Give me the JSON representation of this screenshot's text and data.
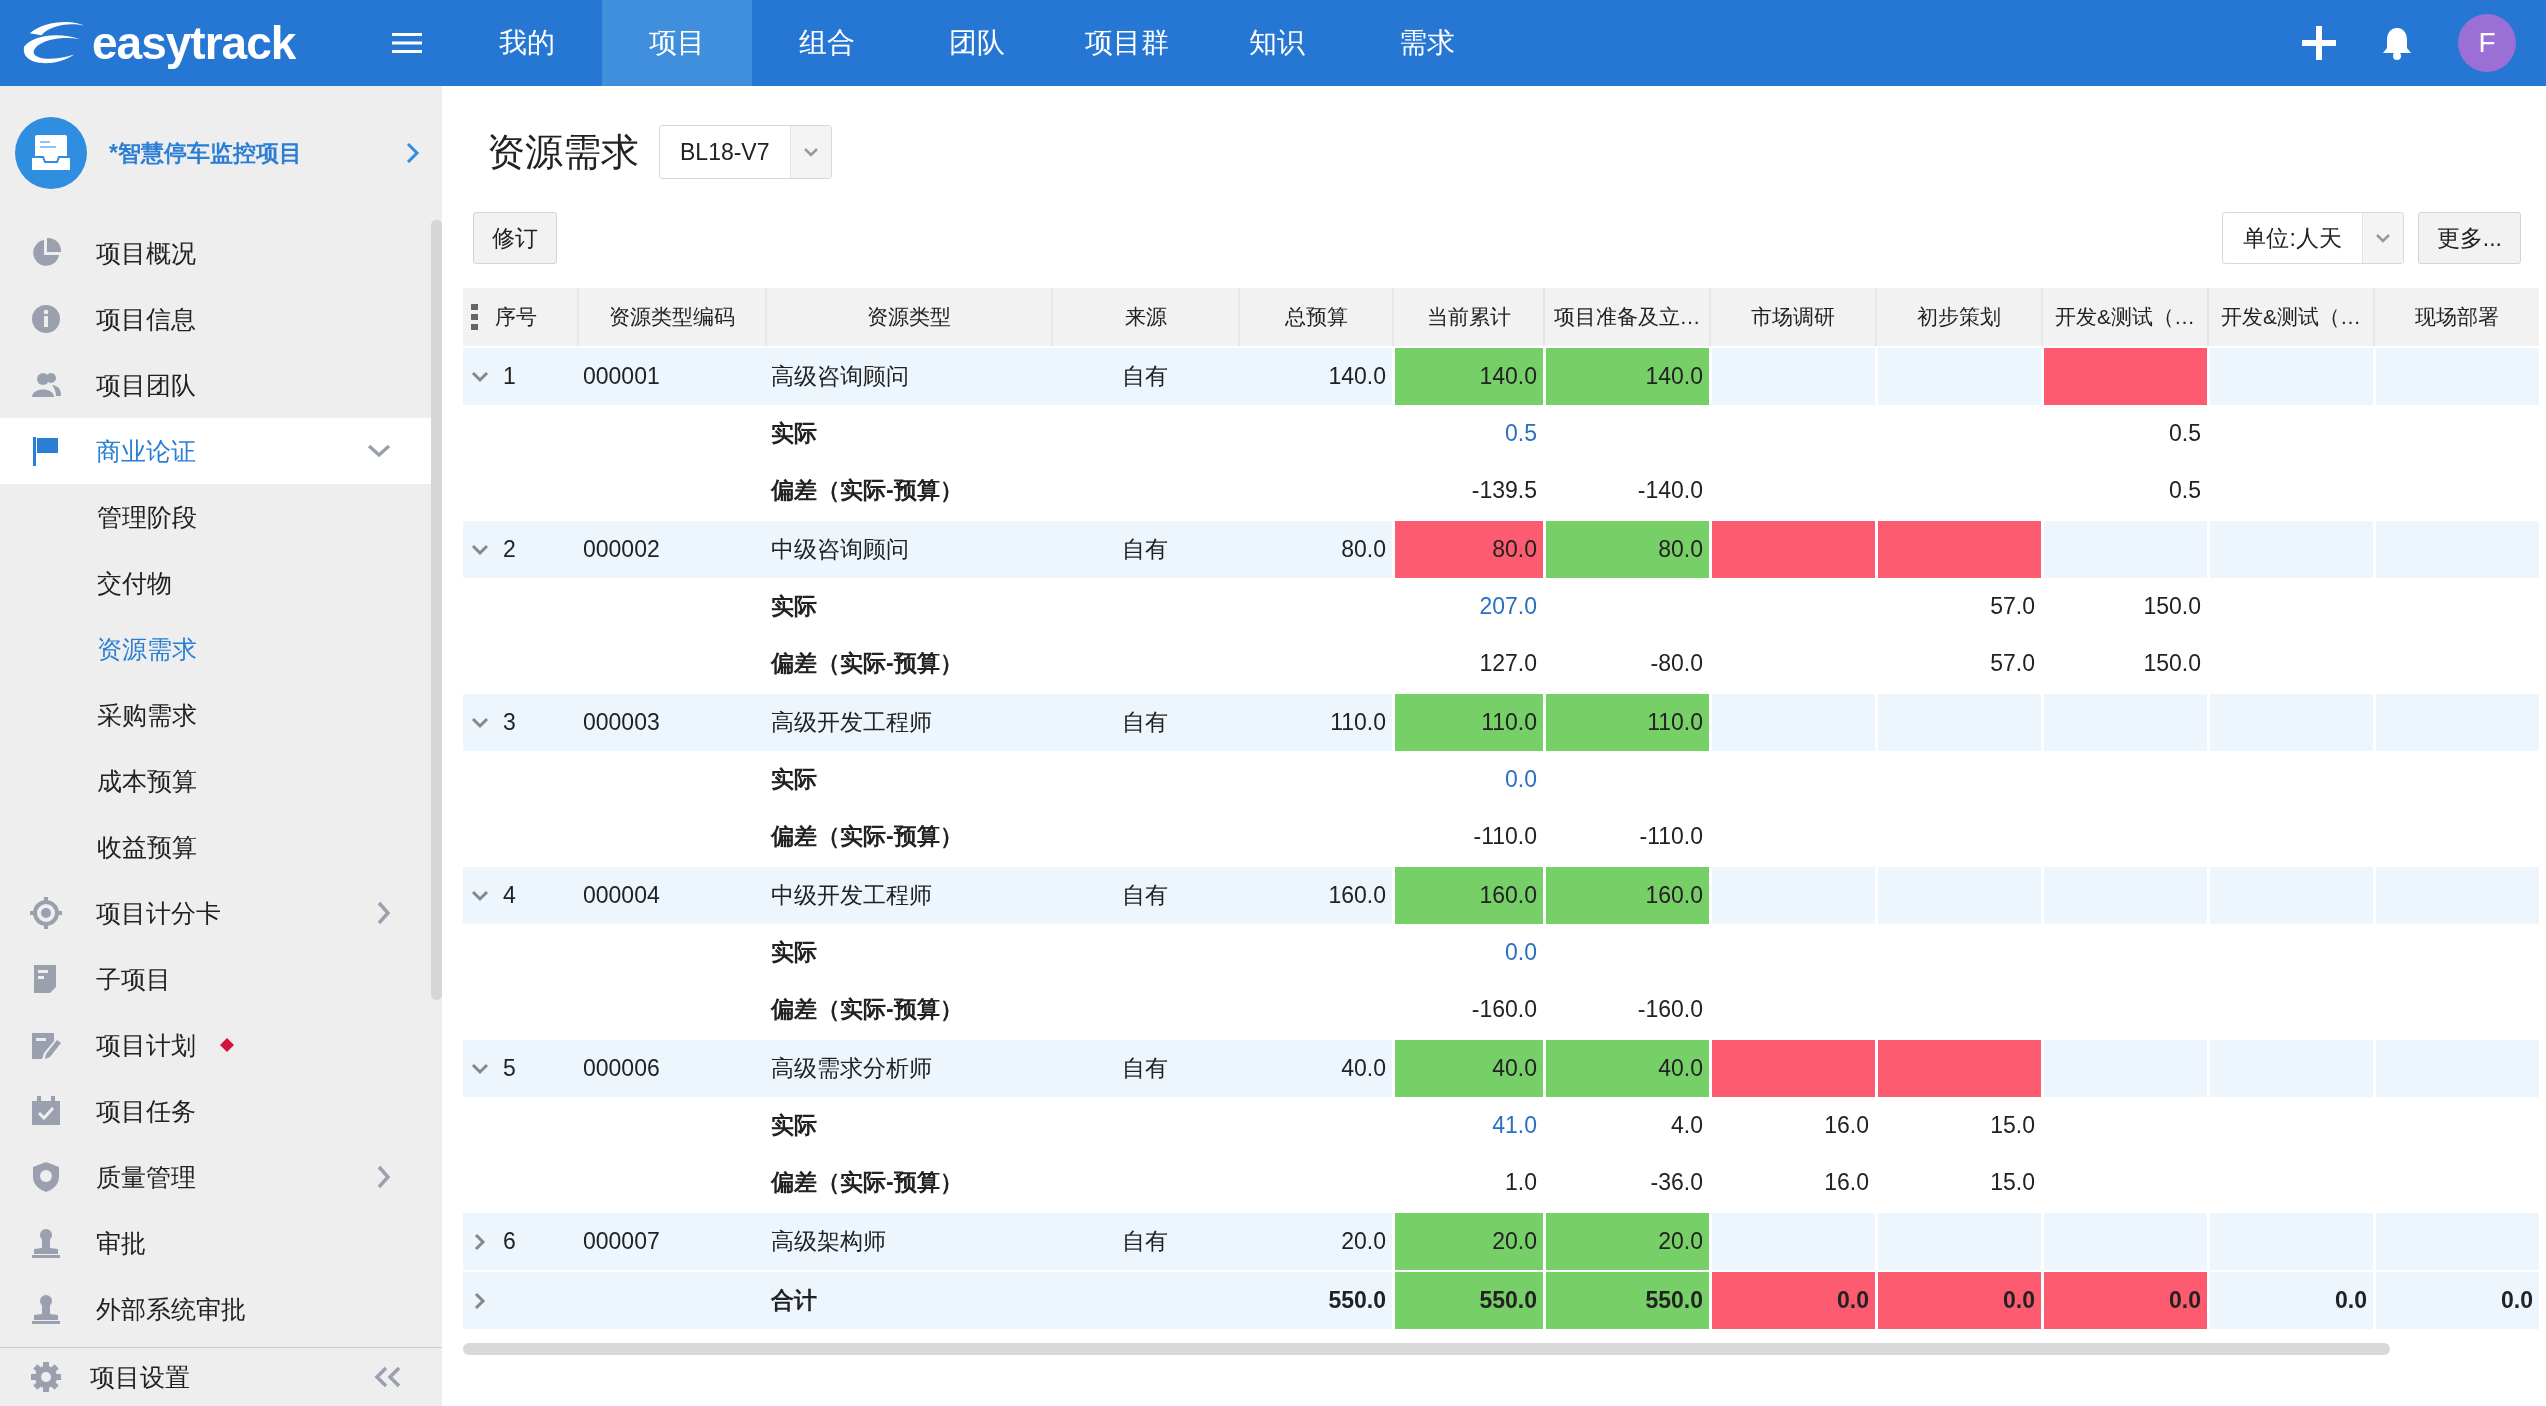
{
  "topbar": {
    "logo": "easytrack",
    "tabs": [
      {
        "label": "我的",
        "selected": false
      },
      {
        "label": "项目",
        "selected": true
      },
      {
        "label": "组合",
        "selected": false
      },
      {
        "label": "团队",
        "selected": false
      },
      {
        "label": "项目群",
        "selected": false
      },
      {
        "label": "知识",
        "selected": false
      },
      {
        "label": "需求",
        "selected": false
      }
    ],
    "avatar": "F"
  },
  "sidebar": {
    "project": "*智慧停车监控项目",
    "items": [
      {
        "label": "项目概况",
        "selected": false,
        "flagged": false
      },
      {
        "label": "项目信息",
        "selected": false,
        "flagged": false
      },
      {
        "label": "项目团队",
        "selected": false,
        "flagged": false
      },
      {
        "label": "商业论证",
        "selected": true,
        "flagged": false,
        "expanded": true,
        "children": [
          {
            "label": "管理阶段",
            "selected": false
          },
          {
            "label": "交付物",
            "selected": false
          },
          {
            "label": "资源需求",
            "selected": true
          },
          {
            "label": "采购需求",
            "selected": false
          },
          {
            "label": "成本预算",
            "selected": false
          },
          {
            "label": "收益预算",
            "selected": false
          }
        ]
      },
      {
        "label": "项目计分卡",
        "selected": false,
        "flagged": false,
        "expanded": false
      },
      {
        "label": "子项目",
        "selected": false,
        "flagged": false
      },
      {
        "label": "项目计划",
        "selected": false,
        "flagged": true
      },
      {
        "label": "项目任务",
        "selected": false,
        "flagged": false
      },
      {
        "label": "质量管理",
        "selected": false,
        "flagged": false,
        "expanded": false
      },
      {
        "label": "审批",
        "selected": false,
        "flagged": false
      },
      {
        "label": "外部系统审批",
        "selected": false,
        "flagged": false
      }
    ],
    "footer": "项目设置"
  },
  "page": {
    "title": "资源需求",
    "version": "BL18-V7",
    "revise_button": "修订",
    "unit": "单位:人天",
    "more_button": "更多..."
  },
  "table": {
    "columns": [
      "序号",
      "资源类型编码",
      "资源类型",
      "来源",
      "总预算",
      "当前累计",
      "项目准备及立…",
      "市场调研",
      "初步策划",
      "开发&测试（…",
      "开发&测试（…",
      "现场部署"
    ],
    "rows": [
      {
        "kind": "resource",
        "expanded": true,
        "cells": [
          {
            "text": "1"
          },
          {
            "text": "000001"
          },
          {
            "text": "高级咨询顾问"
          },
          {
            "text": "自有"
          },
          {
            "text": "140.0"
          },
          {
            "text": "140.0",
            "color": "#77cf68"
          },
          {
            "text": "140.0",
            "color": "#77cf68"
          },
          "",
          "",
          {
            "color": "#fd5b70"
          },
          "",
          ""
        ]
      },
      {
        "kind": "actual",
        "cells": [
          "",
          "",
          {
            "text": "实际"
          },
          "",
          "",
          {
            "text": "0.5"
          },
          "",
          "",
          "",
          {
            "text": "0.5"
          },
          "",
          ""
        ]
      },
      {
        "kind": "deviation",
        "cells": [
          "",
          "",
          {
            "text": "偏差（实际-预算）"
          },
          "",
          "",
          {
            "text": "-139.5"
          },
          {
            "text": "-140.0"
          },
          "",
          "",
          {
            "text": "0.5"
          },
          "",
          ""
        ]
      },
      {
        "kind": "resource",
        "expanded": true,
        "cells": [
          {
            "text": "2"
          },
          {
            "text": "000002"
          },
          {
            "text": "中级咨询顾问"
          },
          {
            "text": "自有"
          },
          {
            "text": "80.0"
          },
          {
            "text": "80.0",
            "color": "#fd5b70"
          },
          {
            "text": "80.0",
            "color": "#77cf68"
          },
          {
            "color": "#fd5b70"
          },
          {
            "color": "#fd5b70"
          },
          "",
          "",
          ""
        ]
      },
      {
        "kind": "actual",
        "cells": [
          "",
          "",
          {
            "text": "实际"
          },
          "",
          "",
          {
            "text": "207.0"
          },
          "",
          "",
          {
            "text": "57.0"
          },
          {
            "text": "150.0"
          },
          "",
          ""
        ]
      },
      {
        "kind": "deviation",
        "cells": [
          "",
          "",
          {
            "text": "偏差（实际-预算）"
          },
          "",
          "",
          {
            "text": "127.0"
          },
          {
            "text": "-80.0"
          },
          "",
          {
            "text": "57.0"
          },
          {
            "text": "150.0"
          },
          "",
          ""
        ]
      },
      {
        "kind": "resource",
        "expanded": true,
        "cells": [
          {
            "text": "3"
          },
          {
            "text": "000003"
          },
          {
            "text": "高级开发工程师"
          },
          {
            "text": "自有"
          },
          {
            "text": "110.0"
          },
          {
            "text": "110.0",
            "color": "#77cf68"
          },
          {
            "text": "110.0",
            "color": "#77cf68"
          },
          "",
          "",
          "",
          "",
          ""
        ]
      },
      {
        "kind": "actual",
        "cells": [
          "",
          "",
          {
            "text": "实际"
          },
          "",
          "",
          {
            "text": "0.0"
          },
          "",
          "",
          "",
          "",
          "",
          ""
        ]
      },
      {
        "kind": "deviation",
        "cells": [
          "",
          "",
          {
            "text": "偏差（实际-预算）"
          },
          "",
          "",
          {
            "text": "-110.0"
          },
          {
            "text": "-110.0"
          },
          "",
          "",
          "",
          "",
          ""
        ]
      },
      {
        "kind": "resource",
        "expanded": true,
        "cells": [
          {
            "text": "4"
          },
          {
            "text": "000004"
          },
          {
            "text": "中级开发工程师"
          },
          {
            "text": "自有"
          },
          {
            "text": "160.0"
          },
          {
            "text": "160.0",
            "color": "#77cf68"
          },
          {
            "text": "160.0",
            "color": "#77cf68"
          },
          "",
          "",
          "",
          "",
          ""
        ]
      },
      {
        "kind": "actual",
        "cells": [
          "",
          "",
          {
            "text": "实际"
          },
          "",
          "",
          {
            "text": "0.0"
          },
          "",
          "",
          "",
          "",
          "",
          ""
        ]
      },
      {
        "kind": "deviation",
        "cells": [
          "",
          "",
          {
            "text": "偏差（实际-预算）"
          },
          "",
          "",
          {
            "text": "-160.0"
          },
          {
            "text": "-160.0"
          },
          "",
          "",
          "",
          "",
          ""
        ]
      },
      {
        "kind": "resource",
        "expanded": true,
        "cells": [
          {
            "text": "5"
          },
          {
            "text": "000006"
          },
          {
            "text": "高级需求分析师"
          },
          {
            "text": "自有"
          },
          {
            "text": "40.0"
          },
          {
            "text": "40.0",
            "color": "#77cf68"
          },
          {
            "text": "40.0",
            "color": "#77cf68"
          },
          {
            "color": "#fd5b70"
          },
          {
            "color": "#fd5b70"
          },
          "",
          "",
          ""
        ]
      },
      {
        "kind": "actual",
        "cells": [
          "",
          "",
          {
            "text": "实际"
          },
          "",
          "",
          {
            "text": "41.0"
          },
          {
            "text": "4.0"
          },
          {
            "text": "16.0"
          },
          {
            "text": "15.0"
          },
          "",
          "",
          ""
        ]
      },
      {
        "kind": "deviation",
        "cells": [
          "",
          "",
          {
            "text": "偏差（实际-预算）"
          },
          "",
          "",
          {
            "text": "1.0"
          },
          {
            "text": "-36.0"
          },
          {
            "text": "16.0"
          },
          {
            "text": "15.0"
          },
          "",
          "",
          ""
        ]
      },
      {
        "kind": "resource",
        "expanded": false,
        "cells": [
          {
            "text": "6"
          },
          {
            "text": "000007"
          },
          {
            "text": "高级架构师"
          },
          {
            "text": "自有"
          },
          {
            "text": "20.0"
          },
          {
            "text": "20.0",
            "color": "#77cf68"
          },
          {
            "text": "20.0",
            "color": "#77cf68"
          },
          "",
          "",
          "",
          "",
          ""
        ]
      },
      {
        "kind": "total",
        "expanded": false,
        "cells": [
          "",
          "",
          {
            "text": "合计"
          },
          "",
          {
            "text": "550.0"
          },
          {
            "text": "550.0",
            "color": "#77cf68"
          },
          {
            "text": "550.0",
            "color": "#77cf68"
          },
          {
            "text": "0.0",
            "color": "#fd5b70"
          },
          {
            "text": "0.0",
            "color": "#fd5b70"
          },
          {
            "text": "0.0",
            "color": "#fd5b70"
          },
          {
            "text": "0.0"
          },
          {
            "text": "0.0"
          }
        ]
      }
    ]
  }
}
